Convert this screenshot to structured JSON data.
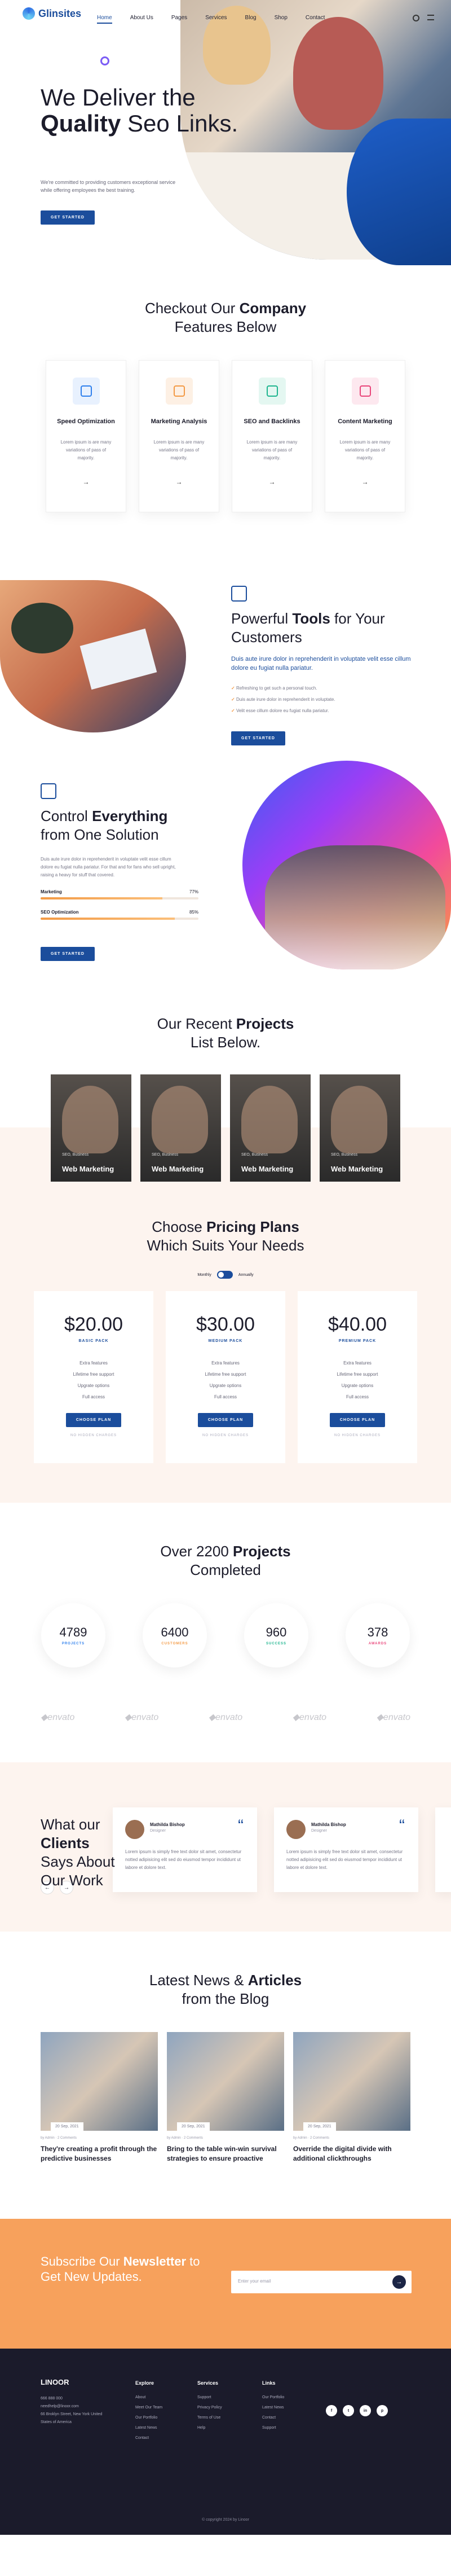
{
  "nav": {
    "logo": "Glinsites",
    "items": [
      "Home",
      "About Us",
      "Pages",
      "Services",
      "Blog",
      "Shop",
      "Contact"
    ]
  },
  "hero": {
    "title_line1": "We Deliver the",
    "title_bold": "Quality",
    "title_rest": "Seo Links.",
    "text": "We're committed to providing customers exceptional service while offering employees the best training.",
    "button": "GET STARTED"
  },
  "company": {
    "title1": "Checkout Our",
    "title_bold": "Company",
    "title2": "Features Below",
    "cards": [
      {
        "title": "Speed Optimization",
        "text": "Lorem ipsum is are many variations of pass of majority.",
        "icon": "speed-icon",
        "color": "#2f80ed",
        "bg": "#e8f1fe"
      },
      {
        "title": "Marketing Analysis",
        "text": "Lorem ipsum is are many variations of pass of majority.",
        "icon": "analysis-icon",
        "color": "#f39a45",
        "bg": "#fdf0e4"
      },
      {
        "title": "SEO and Backlinks",
        "text": "Lorem ipsum is are many variations of pass of majority.",
        "icon": "target-icon",
        "color": "#1fb58f",
        "bg": "#e4f7f1"
      },
      {
        "title": "Content Marketing",
        "text": "Lorem ipsum is are many variations of pass of majority.",
        "icon": "content-icon",
        "color": "#e9457a",
        "bg": "#fde8ef"
      }
    ]
  },
  "tools": {
    "title1": "Powerful",
    "title_bold": "Tools",
    "title2": "for Your Customers",
    "lead": "Duis aute irure dolor in reprehenderit in voluptate velit esse cillum dolore eu fugiat nulla pariatur.",
    "items": [
      "Refreshing to get such a personal touch.",
      "Duis aute irure dolor in reprehenderit in voluptate.",
      "Velit esse cillum dolore eu fugiat nulla pariatur."
    ],
    "button": "GET STARTED"
  },
  "control": {
    "title1": "Control",
    "title_bold": "Everything",
    "title2": "from One Solution",
    "text": "Duis aute irure dolor in reprehenderit in voluptate velit esse cillum dolore eu fugiat nulla pariatur. For that and for fans who sell upright, raising a heavy for stuff that covered.",
    "bars": [
      {
        "label": "Marketing",
        "value": "77%",
        "fraction": 0.77
      },
      {
        "label": "SEO Optimization",
        "value": "85%",
        "fraction": 0.85
      }
    ],
    "button": "GET STARTED"
  },
  "projects": {
    "title1": "Our Recent",
    "title_bold": "Projects",
    "title2": "List Below.",
    "items": [
      {
        "tag": "SEO, Business",
        "title": "Web Marketing"
      },
      {
        "tag": "SEO, Business",
        "title": "Web Marketing"
      },
      {
        "tag": "SEO, Business",
        "title": "Web Marketing"
      },
      {
        "tag": "SEO, Business",
        "title": "Web Marketing"
      }
    ]
  },
  "pricing": {
    "title1": "Choose",
    "title_bold": "Pricing Plans",
    "title2": "Which Suits Your Needs",
    "toggle_left": "Monthly",
    "toggle_right": "Annually",
    "plans": [
      {
        "price": "$20.00",
        "name": "BASIC PACK",
        "features": [
          "Extra features",
          "Lifetime free support",
          "Upgrate options",
          "Full access"
        ],
        "button": "CHOOSE PLAN",
        "note": "NO HIDDEN CHARGES"
      },
      {
        "price": "$30.00",
        "name": "MEDIUM PACK",
        "features": [
          "Extra features",
          "Lifetime free support",
          "Upgrate options",
          "Full access"
        ],
        "button": "CHOOSE PLAN",
        "note": "NO HIDDEN CHARGES"
      },
      {
        "price": "$40.00",
        "name": "PREMIUM PACK",
        "features": [
          "Extra features",
          "Lifetime free support",
          "Upgrate options",
          "Full access"
        ],
        "button": "CHOOSE PLAN",
        "note": "NO HIDDEN CHARGES"
      }
    ]
  },
  "stats": {
    "title1": "Over 2200",
    "title_bold": "Projects",
    "title2": "Completed",
    "items": [
      {
        "value": "4789",
        "label": "PROJECTS",
        "color": "#2f80ed"
      },
      {
        "value": "6400",
        "label": "CUSTOMERS",
        "color": "#f39a45"
      },
      {
        "value": "960",
        "label": "SUCCESS",
        "color": "#1fb58f"
      },
      {
        "value": "378",
        "label": "AWARDS",
        "color": "#e9457a"
      }
    ]
  },
  "logos": [
    "envato",
    "envato",
    "envato",
    "envato",
    "envato"
  ],
  "testimonials": {
    "title1": "What our",
    "title_bold": "Clients",
    "title2": "Says About Our Work",
    "items": [
      {
        "name": "Mathilda Bishop",
        "role": "Designer",
        "text": "Lorem ipsum is simply free text dolor sit amet, consectetur notted adipisicing elit sed do eiusmod tempor incididunt ut labore et dolore text."
      },
      {
        "name": "Mathilda Bishop",
        "role": "Designer",
        "text": "Lorem ipsum is simply free text dolor sit amet, consectetur notted adipisicing elit sed do eiusmod tempor incididunt ut labore et dolore text."
      }
    ]
  },
  "blog": {
    "title1": "Latest News &",
    "title_bold": "Articles",
    "title2": "from the Blog",
    "posts": [
      {
        "date": "20 Sep, 2021",
        "meta": "by Admin  ·  2 Comments",
        "title": "They're creating a profit through the predictive businesses"
      },
      {
        "date": "20 Sep, 2021",
        "meta": "by Admin  ·  2 Comments",
        "title": "Bring to the table win-win survival strategies to ensure proactive"
      },
      {
        "date": "20 Sep, 2021",
        "meta": "by Admin  ·  2 Comments",
        "title": "Override the digital divide with additional clickthroughs"
      }
    ]
  },
  "newsletter": {
    "title1": "Subscribe Our",
    "title_bold": "Newsletter",
    "title2": "to Get New Updates.",
    "placeholder": "Enter your email"
  },
  "footer": {
    "logo": "LINOOR",
    "phone": "666 888 000",
    "email": "needhelp@linoor.com",
    "address": "66 Broklyn Street, New York United States of America",
    "cols": [
      {
        "title": "Explore",
        "links": [
          "About",
          "Meet Our Team",
          "Our Portfolio",
          "Latest News",
          "Contact"
        ]
      },
      {
        "title": "Services",
        "links": [
          "Support",
          "Privacy Policy",
          "Terms of Use",
          "Help"
        ]
      },
      {
        "title": "Links",
        "links": [
          "Our Portfolio",
          "Latest News",
          "Contact",
          "Support"
        ]
      }
    ],
    "social": [
      "f",
      "t",
      "in",
      "p"
    ],
    "copyright": "© copyright 2024 by Linoor"
  }
}
